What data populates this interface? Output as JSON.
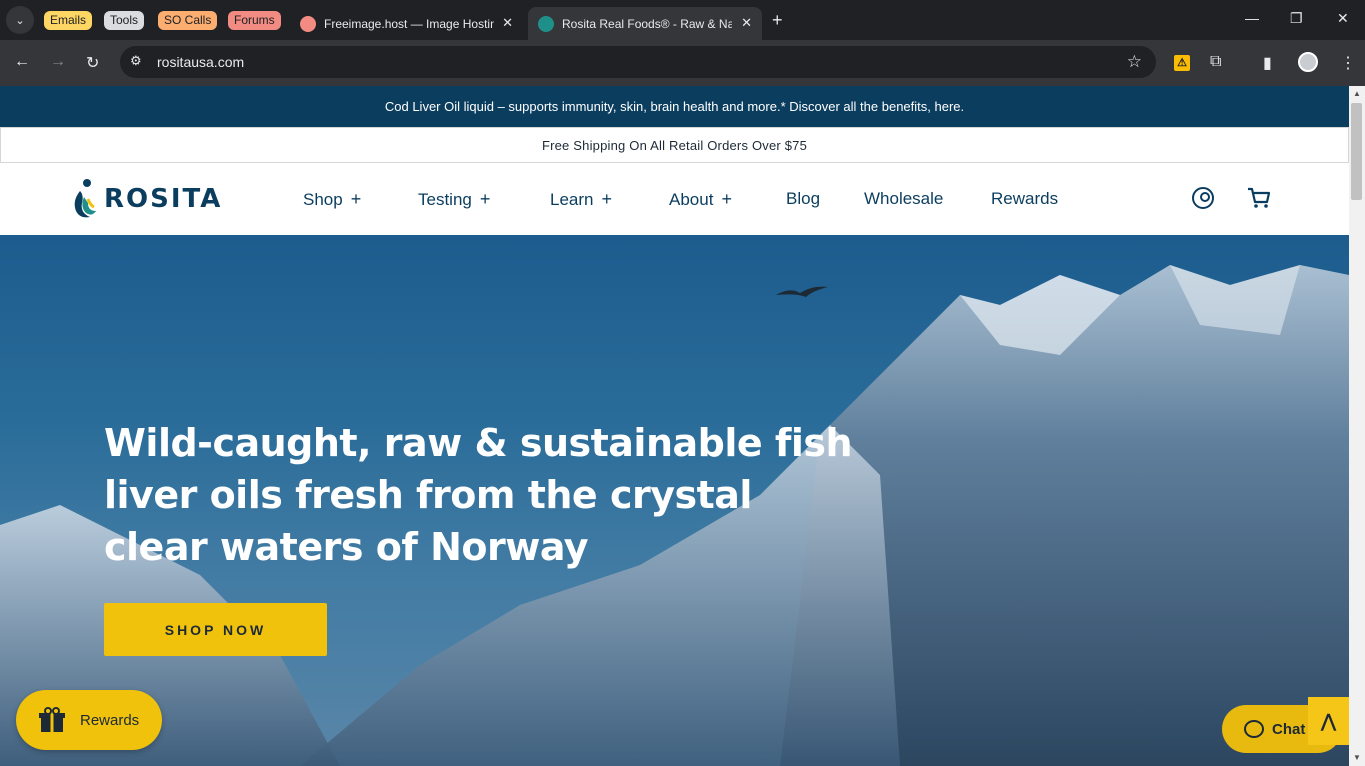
{
  "browser": {
    "groups": [
      {
        "label": "Emails",
        "color": "#fdd663"
      },
      {
        "label": "Tools",
        "color": "#dadce0"
      },
      {
        "label": "SO Calls",
        "color": "#fcad70"
      },
      {
        "label": "Forums",
        "color": "#f28b82"
      }
    ],
    "tabs": [
      {
        "title": "Freeimage.host — Image Hostin",
        "favicon_color": "#f28b82"
      },
      {
        "title": "Rosita Real Foods® - Raw & Na",
        "favicon_color": "#1f8f8a"
      }
    ],
    "new_tab": "+",
    "url": "rositausa.com",
    "window_controls": {
      "minimize": "—",
      "restore": "❐",
      "close": "✕"
    }
  },
  "site": {
    "announcement": "Cod Liver Oil liquid – supports immunity, skin, brain health and more.* Discover all the benefits, here.",
    "shipping": "Free Shipping On All Retail Orders Over $75",
    "logo_text": "ROSITA",
    "nav": [
      {
        "label": "Shop",
        "expandable": true
      },
      {
        "label": "Testing",
        "expandable": true
      },
      {
        "label": "Learn",
        "expandable": true
      },
      {
        "label": "About",
        "expandable": true
      },
      {
        "label": "Blog",
        "expandable": false
      },
      {
        "label": "Wholesale",
        "expandable": false
      },
      {
        "label": "Rewards",
        "expandable": false
      }
    ],
    "hero": {
      "title_lines": [
        "Wild-caught, raw & sustainable fish",
        "liver oils fresh from the crystal",
        "clear waters of Norway"
      ],
      "cta": "SHOP NOW"
    },
    "rewards_widget": "Rewards",
    "chat_widget": "Chat"
  },
  "colors": {
    "brand_navy": "#0b3d5f",
    "cta_yellow": "#f0c20b"
  }
}
